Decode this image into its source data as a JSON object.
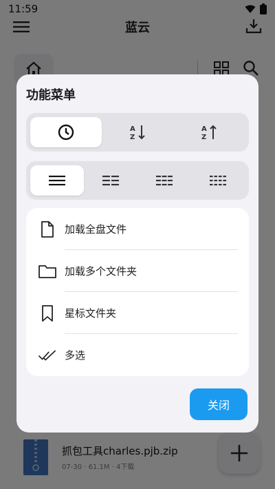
{
  "status": {
    "time": "11:59"
  },
  "appbar": {
    "title": "蓝云"
  },
  "file": {
    "name": "抓包工具charles.pjb.zip",
    "meta": "07-30 · 61.1M · 4下载"
  },
  "dialog": {
    "title": "功能菜单",
    "sort_selected": "time",
    "view_selected": "list-1",
    "items": [
      {
        "icon": "file-icon",
        "label": "加载全盘文件"
      },
      {
        "icon": "folder-icon",
        "label": "加载多个文件夹"
      },
      {
        "icon": "bookmark-icon",
        "label": "星标文件夹"
      },
      {
        "icon": "double-check-icon",
        "label": "多选"
      }
    ],
    "close_label": "关闭"
  },
  "colors": {
    "accent": "#1a9bf0",
    "dialog_bg": "#f3f2f7",
    "segment_bg": "#e3e3e7"
  }
}
